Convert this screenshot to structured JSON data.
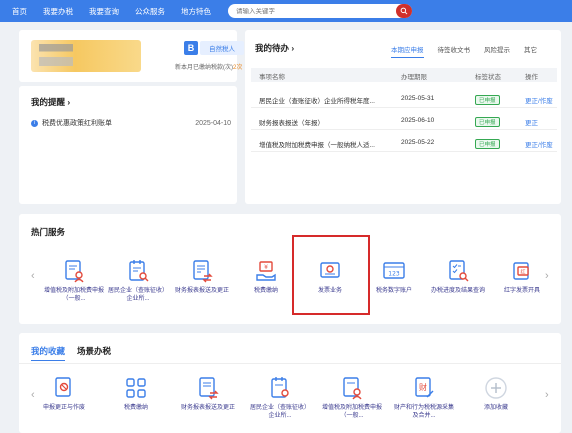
{
  "nav": {
    "items": [
      "首页",
      "我要办税",
      "我要查询",
      "公众服务",
      "地方特色"
    ],
    "search_placeholder": "请输入关键字"
  },
  "user": {
    "badge_letter": "B",
    "taxpayer_type": "自然税人",
    "note_prefix": "新本月已缴纳税款(次)",
    "note_highlight": "2次"
  },
  "reminders": {
    "title": "我的提醒 ›",
    "items": [
      {
        "text": "税费优惠政策红利账单",
        "date": "2025-04-10"
      }
    ]
  },
  "todo": {
    "title": "我的待办 ›",
    "tabs": [
      "本期应申报",
      "待签收文书",
      "风险提示",
      "其它"
    ],
    "active_tab": 0,
    "headers": [
      "事项名称",
      "办理期限",
      "标签状态",
      "操作"
    ],
    "rows": [
      {
        "name": "居民企业（查账征收）企业所得税年度...",
        "deadline": "2025-05-31",
        "status": "已申报",
        "action": "更正/作废"
      },
      {
        "name": "财务报表报送（年报）",
        "deadline": "2025-06-10",
        "status": "已申报",
        "action": "更正"
      },
      {
        "name": "增值税及附加税费申报（一般纳税人适...",
        "deadline": "2025-05-22",
        "status": "已申报",
        "action": "更正/作废"
      }
    ]
  },
  "hot": {
    "title": "热门服务",
    "items": [
      {
        "label": "增值税及附加税费申报（一般...",
        "icon": "doc-person-icon"
      },
      {
        "label": "居民企业（查账征收）企业所...",
        "icon": "calendar-doc-icon"
      },
      {
        "label": "财务报表报送及更正",
        "icon": "report-swap-icon"
      },
      {
        "label": "税费缴纳",
        "icon": "pay-icon"
      },
      {
        "label": "发票业务",
        "icon": "invoice-icon"
      },
      {
        "label": "税务数字账户",
        "icon": "digital-account-icon"
      },
      {
        "label": "办税进度及结果查询",
        "icon": "progress-query-icon"
      },
      {
        "label": "红字发票开具",
        "icon": "red-invoice-icon"
      }
    ]
  },
  "favorites": {
    "tabs": [
      "我的收藏",
      "场景办税"
    ],
    "active_tab": 0,
    "items": [
      {
        "label": "申报更正与作废",
        "icon": "correction-icon"
      },
      {
        "label": "税费缴纳",
        "icon": "grid-apps-icon"
      },
      {
        "label": "财务报表报送及更正",
        "icon": "report-swap-icon"
      },
      {
        "label": "居民企业（查账征收）企业所...",
        "icon": "calendar-doc-icon"
      },
      {
        "label": "增值税及附加税费申报（一般...",
        "icon": "doc-person-icon"
      },
      {
        "label": "财产和行为税税源采集及合并...",
        "icon": "property-tax-icon"
      },
      {
        "label": "添加收藏",
        "icon": "plus-icon"
      }
    ]
  },
  "colors": {
    "primary": "#3b7ee8",
    "highlight_box": "#d62a2a",
    "status_green": "#35a852"
  }
}
